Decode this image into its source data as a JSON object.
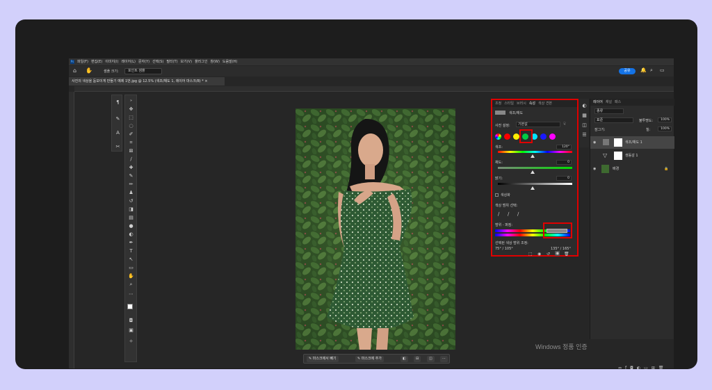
{
  "app": {
    "logo": "Ps",
    "menu": [
      "파일(F)",
      "편집(E)",
      "이미지(I)",
      "레이어(L)",
      "문자(Y)",
      "선택(S)",
      "필터(T)",
      "보기(V)",
      "플러그인",
      "창(W)",
      "도움말(H)"
    ]
  },
  "options_bar": {
    "brush_size_label": "샘플 크기:",
    "brush_size_value": "포인트 샘플",
    "share_label": "공유"
  },
  "document_tab": {
    "title": "사진의 색상을 돋보이게 만들기 예제 1번.jpg @ 12.5% (색조/채도 1, 레이어 마스크/8) *"
  },
  "properties_panel": {
    "tabs": [
      "조정",
      "스타일",
      "브러시",
      "속성",
      "색상 견본"
    ],
    "active_tab": "속성",
    "title": "색조/채도",
    "preset_label": "사전 설정:",
    "preset_value": "기본값",
    "hue_label": "색조:",
    "hue_value": "120°",
    "saturation_label": "채도:",
    "saturation_value": "0",
    "lightness_label": "밝기:",
    "lightness_value": "0",
    "colorize_label": "색상화",
    "color_range_label": "색상 범위 선택:",
    "range_label": "범위 - 퍼짐:",
    "selected_range_label": "선택된 색상 범위 조정:",
    "range_left": "75° / 105°",
    "range_right": "135° / 165°",
    "swatch_colors": [
      "#ff0000",
      "#ffee00",
      "#00cc44",
      "#00e5ff",
      "#1a1aff",
      "#ff00ff"
    ],
    "selected_swatch": "green"
  },
  "layers_panel": {
    "tabs": [
      "레이어",
      "채널",
      "패스"
    ],
    "filter_label": "종류",
    "blend_mode": "표준",
    "opacity_label": "불투명도:",
    "opacity_value": "100%",
    "lock_label": "잠그기:",
    "fill_label": "칠:",
    "fill_value": "100%",
    "layers": [
      {
        "name": "색조/채도 1"
      },
      {
        "name": "생동감 1"
      },
      {
        "name": "배경"
      }
    ]
  },
  "context_bar": {
    "subtract_label": "마스크에서 빼기",
    "add_label": "마스크에 추가"
  },
  "watermark": "Windows 정품 인증"
}
